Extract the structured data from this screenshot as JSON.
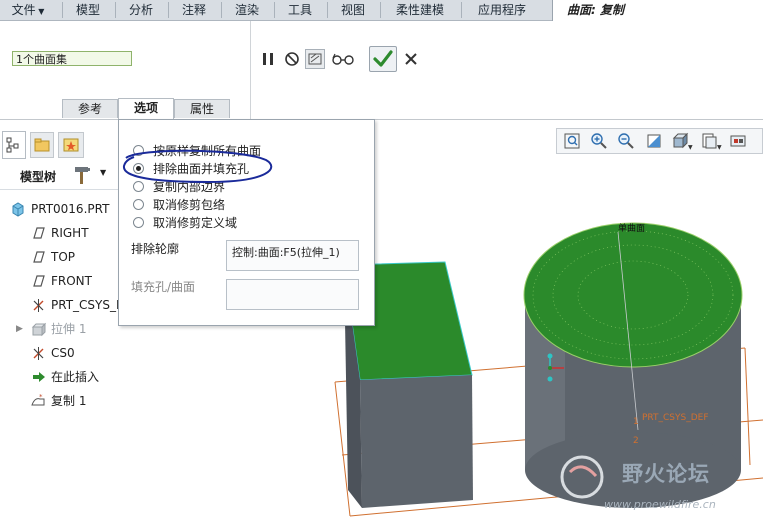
{
  "menubar": {
    "file": "文件",
    "tabs": [
      "模型",
      "分析",
      "注释",
      "渲染",
      "工具",
      "视图",
      "柔性建模",
      "应用程序"
    ],
    "context_tab": "曲面: 复制"
  },
  "dashboard": {
    "surface_set_value": "1个曲面集",
    "tabs": [
      "参考",
      "选项",
      "属性"
    ],
    "active_tab": "选项",
    "buttons": {
      "pause": "pause-icon",
      "no_preview": "no-preview-icon",
      "verify": "verify-icon",
      "glasses": "glasses-icon",
      "ok": "check-icon",
      "cancel": "close-icon"
    },
    "ok_color": "#2e8b2e"
  },
  "options": {
    "radios": [
      {
        "label": "按原样复制所有曲面",
        "checked": false
      },
      {
        "label": "排除曲面并填充孔",
        "checked": true
      },
      {
        "label": "复制内部边界",
        "checked": false
      },
      {
        "label": "取消修剪包络",
        "checked": false
      },
      {
        "label": "取消修剪定义域",
        "checked": false
      }
    ],
    "exclude_label": "排除轮廓",
    "exclude_value": "控制:曲面:F5(拉伸_1)",
    "fill_label": "填充孔/曲面",
    "fill_value": ""
  },
  "tree": {
    "header": "模型树",
    "items": [
      {
        "label": "PRT0016.PRT",
        "icon": "part-icon"
      },
      {
        "label": "RIGHT",
        "icon": "datum-plane-icon"
      },
      {
        "label": "TOP",
        "icon": "datum-plane-icon"
      },
      {
        "label": "FRONT",
        "icon": "datum-plane-icon"
      },
      {
        "label": "PRT_CSYS_DEF",
        "icon": "csys-icon"
      },
      {
        "label": "拉伸 1",
        "icon": "extrude-icon"
      },
      {
        "label": "CS0",
        "icon": "csys-icon"
      },
      {
        "label": "在此插入",
        "icon": "insert-here-icon"
      },
      {
        "label": "复制 1",
        "icon": "copy-surface-icon"
      }
    ]
  },
  "viewport": {
    "surface_label": "单曲面",
    "csys_label": "PRT_CSYS_DEF",
    "watermark_title": "野火论坛",
    "watermark_url": "www.proewildfire.cn",
    "colors": {
      "solid": "#5d646c",
      "selected_surface": "#2b8a2b",
      "edge": "#d07030"
    }
  }
}
